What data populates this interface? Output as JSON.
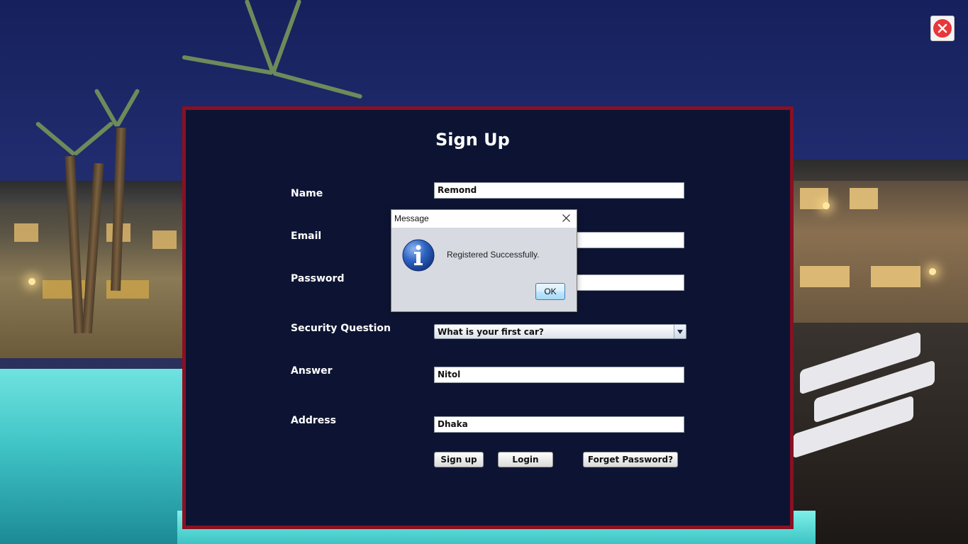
{
  "window": {
    "close_icon": "close-icon",
    "accent_color": "#8a1022",
    "panel_color": "#0d1433"
  },
  "form": {
    "title": "Sign Up",
    "labels": {
      "name": "Name",
      "email": "Email",
      "password": "Password",
      "security_question": "Security Question",
      "answer": "Answer",
      "address": "Address"
    },
    "values": {
      "name": "Remond",
      "email": "",
      "password": "",
      "answer": "Nitol",
      "address": "Dhaka"
    },
    "security_question_selected": "What is your first car?",
    "buttons": {
      "signup": "Sign up",
      "login": "Login",
      "forget_password": "Forget Password?"
    }
  },
  "dialog": {
    "title": "Message",
    "message": "Registered Successfully.",
    "ok": "OK",
    "icon": "info-icon"
  }
}
